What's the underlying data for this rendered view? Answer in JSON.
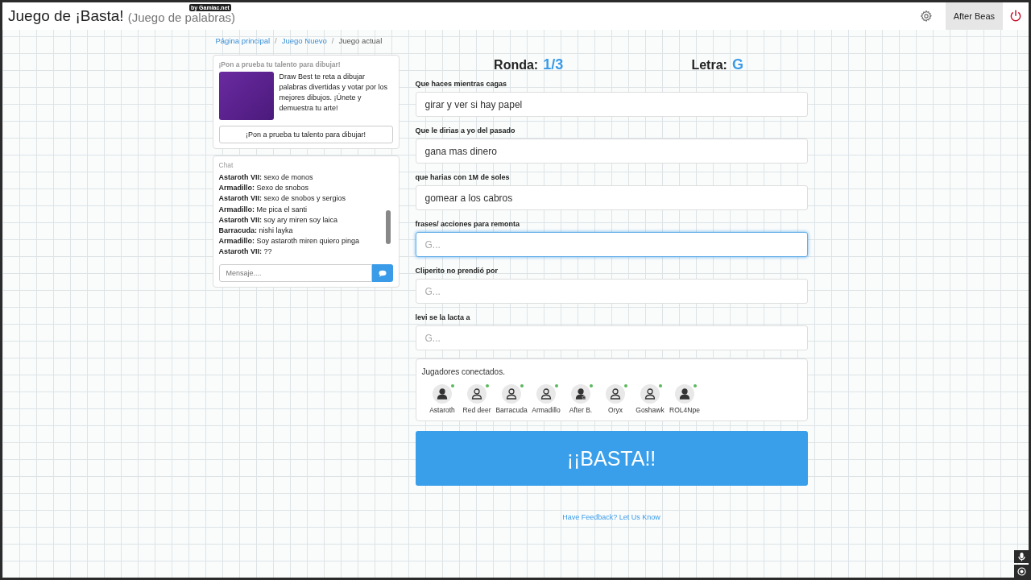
{
  "header": {
    "title": "Juego de ¡Basta!",
    "subtitle": "(Juego de palabras)",
    "badge": "by Gamiac.net",
    "user": "After Beas"
  },
  "breadcrumb": [
    {
      "label": "Página principal",
      "current": false
    },
    {
      "separator": "/",
      "label": "Juego Nuevo",
      "current": false
    },
    {
      "separator": "/",
      "label": "Juego actual",
      "current": true
    }
  ],
  "promo": {
    "heading": "¡Pon a prueba tu talento para dibujar!",
    "text": "Draw Best te reta a dibujar palabras divertidas y votar por los mejores dibujos. ¡Únete y demuestra tu arte!",
    "button": "¡Pon a prueba tu talento para dibujar!"
  },
  "chat": {
    "title": "Chat",
    "messages": [
      "**Astaroth VII:** sexo de monos",
      "**Armadillo:** Sexo de snobos",
      "**Astaroth VII:** sexo de snobos y sergios",
      "**Armadillo:** Me pica el santi",
      "**Astaroth VII:** soy ary miren soy laica",
      "**Barracuda:** nishi layka",
      "**Armadillo:** Soy astaroth miren quiero pinga",
      "**Astaroth VII:** ??"
    ],
    "placeholder": "Mensaje...."
  },
  "round": {
    "label": "Ronda:",
    "value": "1/3"
  },
  "letter": {
    "label": "Letra:",
    "value": "G"
  },
  "fields": [
    {
      "label": "Que haces mientras cagas",
      "value": "girar y ver si hay papel",
      "focused": false
    },
    {
      "label": "Que le dirias a yo del pasado",
      "value": "gana mas dinero",
      "focused": false
    },
    {
      "label": "que harias con 1M de soles",
      "value": "gomear a los cabros",
      "focused": false
    },
    {
      "label": "frases/ acciones para remonta",
      "placeholder": "G...",
      "focused": true
    },
    {
      "label": "Cliperito no prendió por",
      "placeholder": "G...",
      "focused": false
    },
    {
      "label": "levi se la lacta a",
      "placeholder": "G...",
      "focused": false
    }
  ],
  "players": {
    "title": "Jugadores conectados.",
    "items": [
      {
        "name": "Astaroth",
        "kind": "member",
        "online": true
      },
      {
        "name": "Red deer",
        "kind": "guest",
        "online": true
      },
      {
        "name": "Barracuda",
        "kind": "guest",
        "online": true
      },
      {
        "name": "Armadillo",
        "kind": "guest",
        "online": true
      },
      {
        "name": "After B.",
        "kind": "self",
        "online": true
      },
      {
        "name": "Oryx",
        "kind": "guest",
        "online": true
      },
      {
        "name": "Goshawk",
        "kind": "guest",
        "online": true
      },
      {
        "name": "ROL4Npe",
        "kind": "member",
        "online": true
      }
    ]
  },
  "basta_button": "¡¡BASTA!!",
  "feedback_link": "Have Feedback? Let Us Know"
}
